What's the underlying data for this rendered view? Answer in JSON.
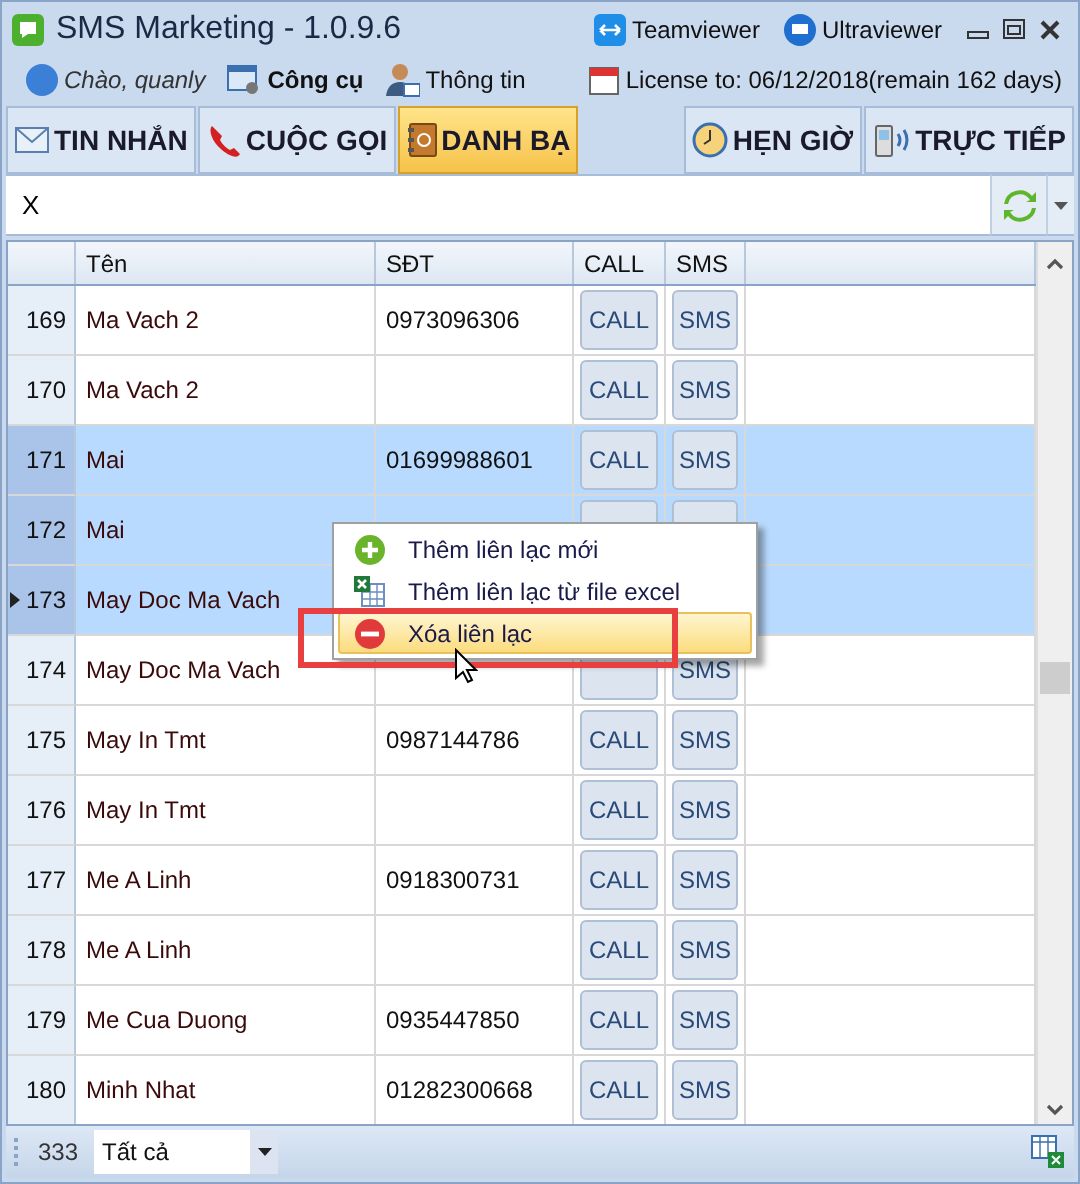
{
  "window": {
    "title": "SMS Marketing - 1.0.9.6",
    "links": [
      "Teamviewer",
      "Ultraviewer"
    ]
  },
  "toolbar": {
    "greeting": "Chào, quanly",
    "items": [
      "Công cụ",
      "Thông tin"
    ],
    "license": "License to: 06/12/2018(remain 162 days)"
  },
  "tabs": [
    {
      "label": "TIN NHẮN",
      "selected": false
    },
    {
      "label": "CUỘC GỌI",
      "selected": false
    },
    {
      "label": "DANH BẠ",
      "selected": true
    },
    {
      "label": "HẸN GIỜ",
      "selected": false
    },
    {
      "label": "TRỰC TIẾP",
      "selected": false
    }
  ],
  "search": {
    "value": "X"
  },
  "table": {
    "columns": [
      "Tên",
      "SĐT",
      "CALL",
      "SMS"
    ],
    "rows": [
      {
        "num": "169",
        "name": "Ma Vach 2",
        "phone": "0973096306",
        "call": "CALL",
        "sms": "SMS",
        "selected": false,
        "current": false
      },
      {
        "num": "170",
        "name": "Ma Vach 2",
        "call": "CALL",
        "sms": "SMS",
        "selected": false,
        "current": false
      },
      {
        "num": "171",
        "name": "Mai",
        "phone": "01699988601",
        "call": "CALL",
        "sms": "SMS",
        "selected": true,
        "current": false
      },
      {
        "num": "172",
        "name": "Mai",
        "selected": true,
        "current": false
      },
      {
        "num": "173",
        "name": "May Doc Ma Vach",
        "selected": true,
        "current": true
      },
      {
        "num": "174",
        "name": "May Doc Ma Vach",
        "sms": "SMS",
        "selected": false,
        "current": false
      },
      {
        "num": "175",
        "name": "May In Tmt",
        "phone": "0987144786",
        "call": "CALL",
        "sms": "SMS",
        "selected": false,
        "current": false
      },
      {
        "num": "176",
        "name": "May In Tmt",
        "call": "CALL",
        "sms": "SMS",
        "selected": false,
        "current": false
      },
      {
        "num": "177",
        "name": "Me A Linh",
        "phone": "0918300731",
        "call": "CALL",
        "sms": "SMS",
        "selected": false,
        "current": false
      },
      {
        "num": "178",
        "name": "Me A Linh",
        "call": "CALL",
        "sms": "SMS",
        "selected": false,
        "current": false
      },
      {
        "num": "179",
        "name": "Me Cua Duong",
        "phone": "0935447850",
        "call": "CALL",
        "sms": "SMS",
        "selected": false,
        "current": false
      },
      {
        "num": "180",
        "name": "Minh Nhat",
        "phone": "01282300668",
        "call": "CALL",
        "sms": "SMS",
        "selected": false,
        "current": false
      }
    ]
  },
  "context_menu": [
    {
      "label": "Thêm liên lạc mới",
      "selected": false
    },
    {
      "label": "Thêm liên lạc từ file excel",
      "selected": false
    },
    {
      "label": "Xóa liên lạc",
      "selected": true
    }
  ],
  "status_bar": {
    "count": "333",
    "filter": "Tất cả"
  }
}
